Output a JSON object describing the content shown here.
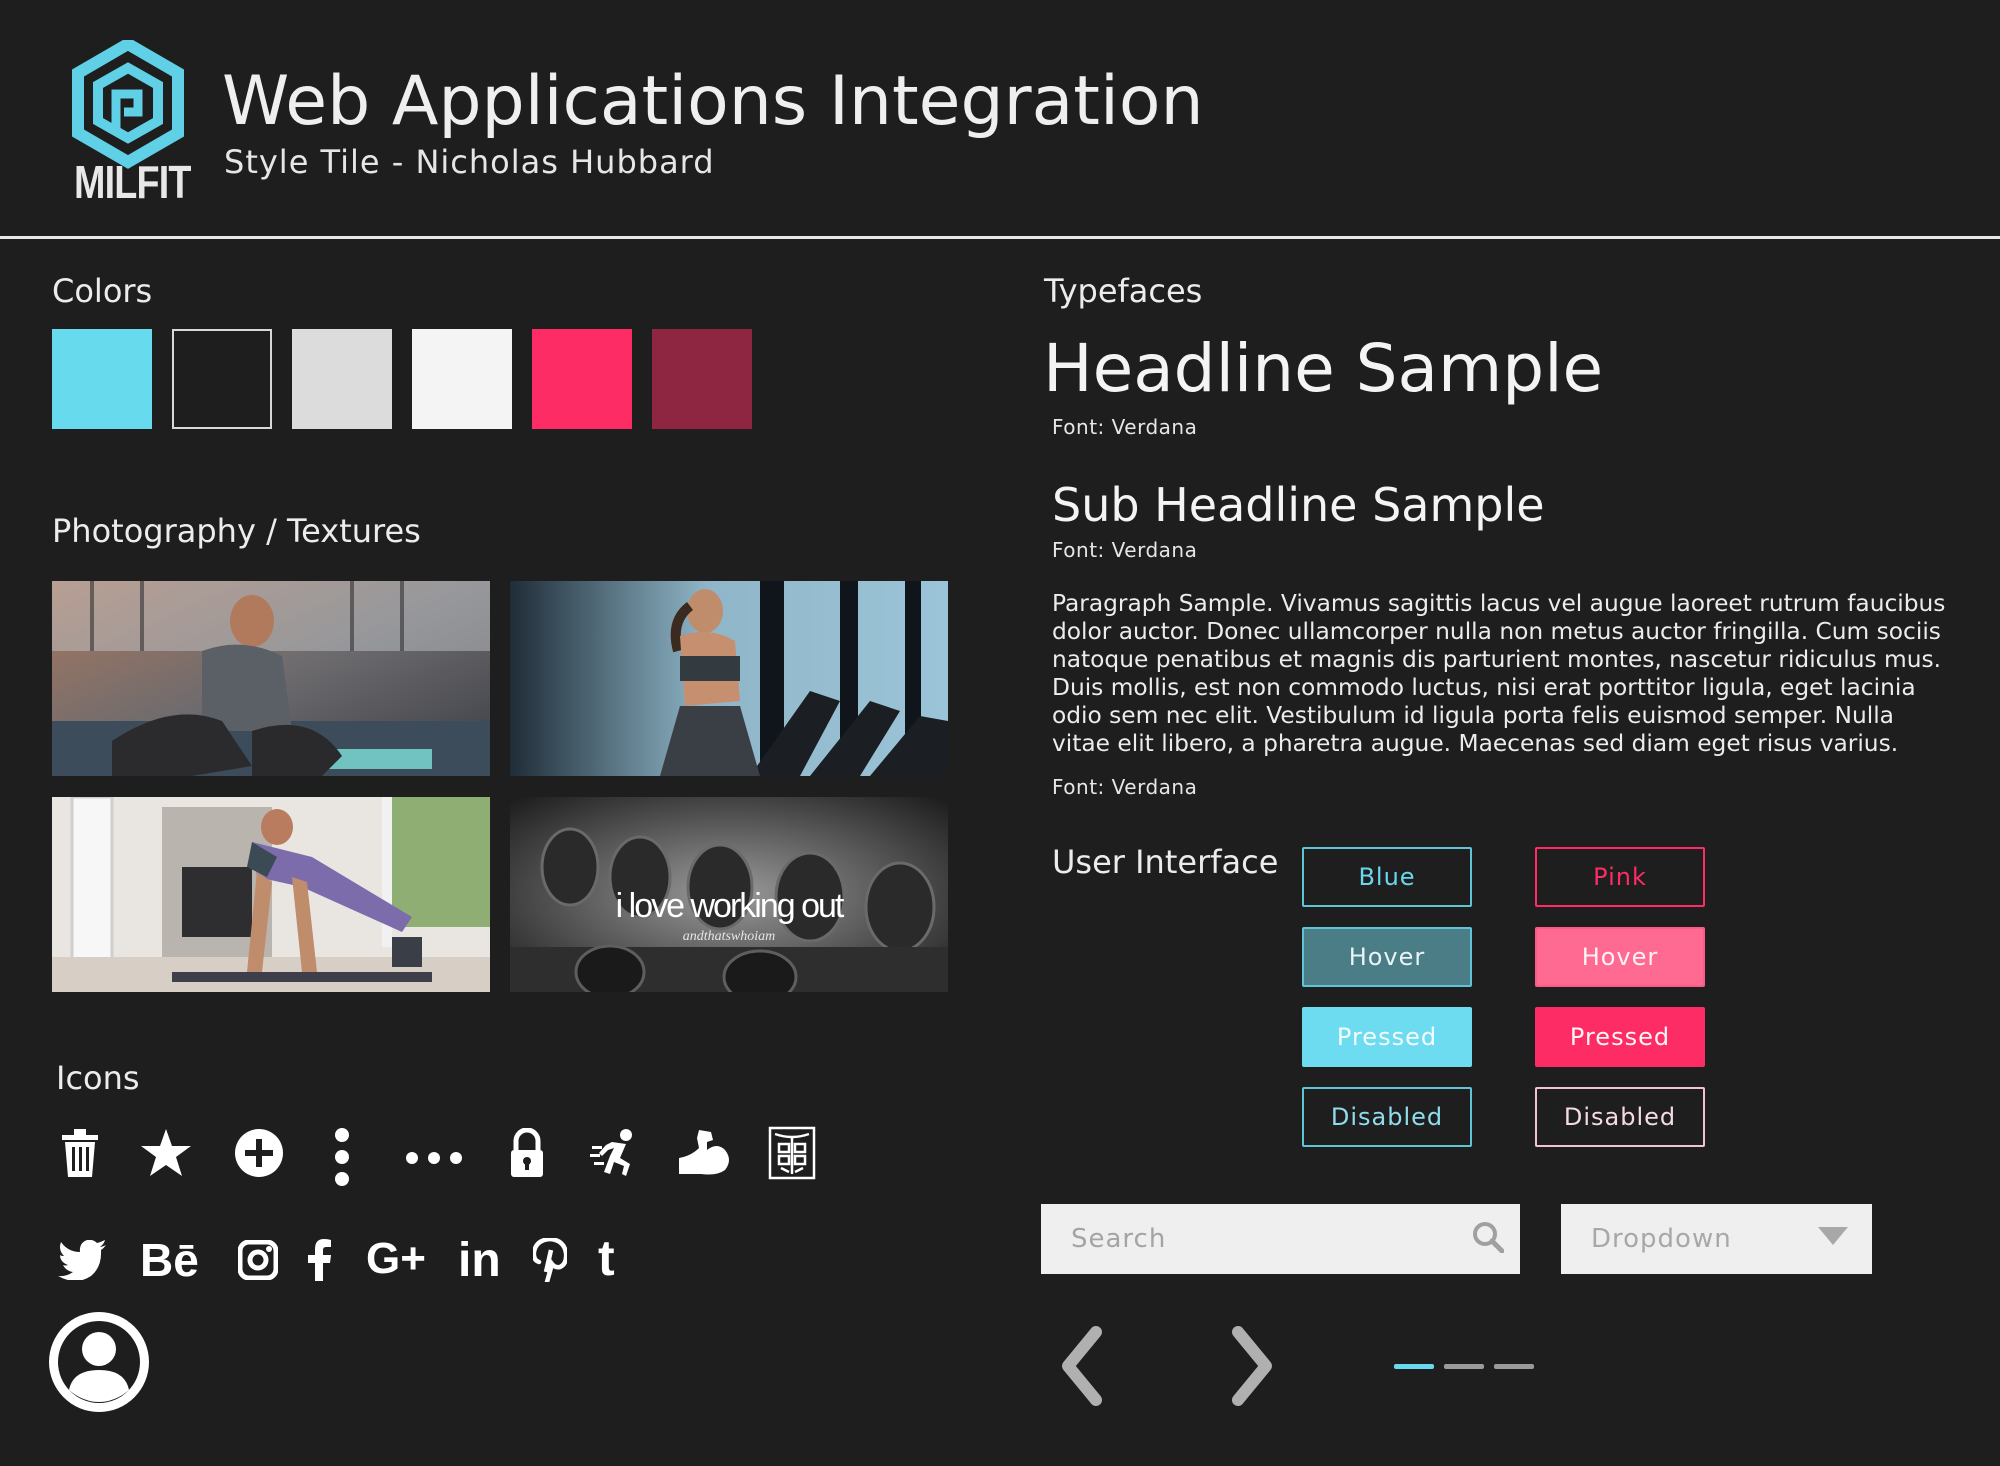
{
  "header": {
    "logo_text": "MILFIT",
    "title": "Web Applications Integration",
    "subtitle": "Style Tile - Nicholas Hubbard"
  },
  "colors": {
    "heading": "Colors",
    "swatches": [
      "#67daee",
      "#1e1e1f",
      "#dcdcdc",
      "#f4f4f4",
      "#fe2c64",
      "#8e2641"
    ]
  },
  "photography": {
    "heading": "Photography / Textures",
    "overlay_text": "i love working out",
    "overlay_subtext": "andthatswhoiam"
  },
  "icons": {
    "heading": "Icons",
    "items": [
      "trash-icon",
      "star-icon",
      "plus-circle-icon",
      "vertical-dots-icon",
      "horizontal-dots-icon",
      "lock-icon",
      "running-icon",
      "flexed-bicep-icon",
      "abs-icon"
    ],
    "social": [
      "twitter-icon",
      "behance-icon",
      "instagram-icon",
      "facebook-icon",
      "google-plus-icon",
      "linkedin-icon",
      "pinterest-icon",
      "tumblr-icon"
    ],
    "avatar": "user-avatar-icon"
  },
  "typefaces": {
    "heading": "Typefaces",
    "headline": "Headline Sample",
    "headline_font": "Font: Verdana",
    "subheadline": "Sub Headline Sample",
    "subheadline_font": "Font: Verdana",
    "paragraph": "Paragraph Sample. Vivamus sagittis lacus vel augue laoreet rutrum faucibus dolor auctor. Donec ullamcorper nulla non metus auctor fringilla. Cum sociis natoque penatibus et magnis dis parturient montes, nascetur ridiculus mus. Duis mollis, est non commodo luctus, nisi erat porttitor ligula, eget lacinia odio sem nec elit. Vestibulum id ligula porta felis euismod semper. Nulla vitae elit libero, a pharetra augue. Maecenas sed diam eget risus varius.",
    "paragraph_font": "Font: Verdana"
  },
  "ui": {
    "heading": "User Interface",
    "blue_buttons": [
      "Blue",
      "Hover",
      "Pressed",
      "Disabled"
    ],
    "pink_buttons": [
      "Pink",
      "Hover",
      "Pressed",
      "Disabled"
    ],
    "search_placeholder": "Search",
    "dropdown_label": "Dropdown",
    "pagination": {
      "total": 3,
      "active": 1
    },
    "accent_blue": "#67daee",
    "accent_pink": "#fe2c64"
  }
}
